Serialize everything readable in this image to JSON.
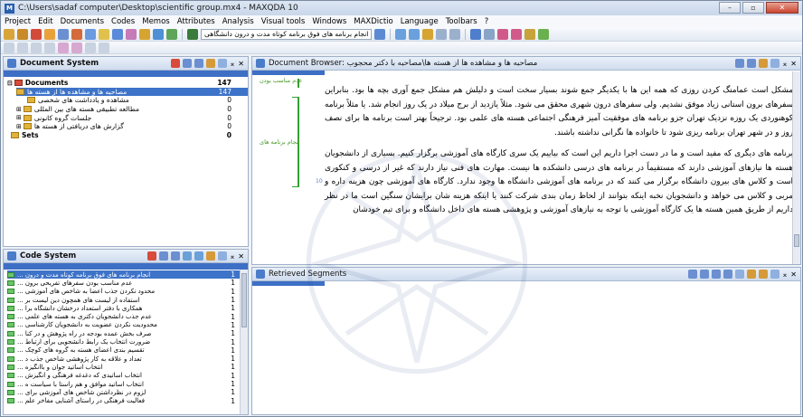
{
  "window": {
    "title": "C:\\Users\\sadaf computer\\Desktop\\scientific group.mx4 - MAXQDA 10"
  },
  "menu": [
    "Project",
    "Edit",
    "Documents",
    "Codes",
    "Memos",
    "Attributes",
    "Analysis",
    "Visual tools",
    "Windows",
    "MAXDictio",
    "Language",
    "Toolbars",
    "?"
  ],
  "toolbar": {
    "combo_label": "انجام برنامه های فوق برنامه کوتاه مدت و درون دانشگاهی"
  },
  "document_system": {
    "title": "Document System",
    "root": {
      "label": "Documents",
      "count": "147"
    },
    "items": [
      {
        "label": "مصاحبه ها و مشاهده ها از هسته ها",
        "count": "147",
        "selected": true
      },
      {
        "label": "مشاهده و یادداشت های شخصی",
        "count": "0"
      },
      {
        "label": "مطالعه تطبیقی هسته های بین المللی",
        "count": "0"
      },
      {
        "label": "جلسات گروه کانونی",
        "count": "0"
      },
      {
        "label": "گزارش های دریافتی از هسته ها",
        "count": "0"
      }
    ],
    "sets": {
      "label": "Sets",
      "count": "0"
    }
  },
  "code_system": {
    "title": "Code System",
    "items": [
      {
        "label": "انجام برنامه های فوق برنامه کوتاه مدت و درون ...",
        "count": "1",
        "selected": true
      },
      {
        "label": "عدم مناسب بودن سفرهای تفریحی برون ...",
        "count": "1"
      },
      {
        "label": "محدود نکردن جذب اعضا به شاخص های آموزشی ...",
        "count": "1"
      },
      {
        "label": "استفاده از لیست های همچون دین لیست بر ...",
        "count": "1"
      },
      {
        "label": "همکاری با دفتر استعداد درخشان دانشگاه برا ...",
        "count": "1"
      },
      {
        "label": "عدم جذب دانشجویان دکتری به هسته های علمی ...",
        "count": "1"
      },
      {
        "label": "محدودیت نکردن عضویت به دانشجویان کارشناسی ...",
        "count": "1"
      },
      {
        "label": "صرف بخش عمده بودجه در راه پژوهش و در کنا ...",
        "count": "1"
      },
      {
        "label": "ضرورت انتخاب یک رابط دانشجویی برای ارتباط ...",
        "count": "1"
      },
      {
        "label": "تقسیم بندی اعضای هسته به گروه های کوچک ...",
        "count": "1"
      },
      {
        "label": "تعداد و علاقه به کار پژوهشی شاخص جذب د ...",
        "count": "1"
      },
      {
        "label": "انتخاب اساتید جوان و باانگیزه ...",
        "count": "1"
      },
      {
        "label": "انتخاب اساتیدی که دغدغه فرهنگی و انگیزش ...",
        "count": "1"
      },
      {
        "label": "انتخاب اساتید موافق و هم راستا با سیاست ه ...",
        "count": "1"
      },
      {
        "label": "لزوم در نظرداشتن شاخص های آموزشی برای ...",
        "count": "1"
      },
      {
        "label": "فعالیت فرهنگی در راستای آشنایی مفاخر علم ...",
        "count": "1"
      }
    ]
  },
  "document_browser": {
    "title": "Document Browser: مصاحبه ها و مشاهده ها از هسته ها\\مصاحبه با دکتر محجوب",
    "code_labels": [
      "عدم مناسب بودن",
      "انجام برنامه های"
    ],
    "para_number": "10",
    "paragraphs": [
      "مشکل است عمامنگ کردن روزی که همه این ها با یکدیگر جمع شوند بسیار سخت است و دلیلش هم مشکل جمع آوری بچه ها بود. بنابراین سفرهای برون استانی زیاد موفق نشدیم. ولی سفرهای درون شهری محقق می شود. مثلاً یازدید از برج میلاد در یک روز انجام شد. یا مثلاً برنامه کوهنوردی یک روزه نزدیک تهران جزو برنامه های موفقیت آمیز فرهنگی اجتماعی هسته های علمی بود. ترجیحاً بهتر است برنامه ها برای نصف روز و در شهر تهران برنامه ریزی شود تا خانواده ها نگرانی نداشته باشند.",
      "برنامه های دیگری که مفید است و ما در دست اجرا داریم این است که بیاییم یک سری کارگاه های آموزشی برگزار کنیم. بسیاری از دانشجویان هسته ها نیازهای آموزشی دارند که مستقیماً در برنامه های درسی دانشکده ها نیست. مهارت های فنی نیاز دارند که غیر از درسی و کنکوری است و کلاس های بیرون دانشگاه برگزار می کنند که در برنامه های آموزشی دانشگاه ها وجود ندارد. کارگاه های آموزشی چون هزینه داره و مربی و کلاس می خواهد و دانشجویان نخبه اینکه بتوانند از لحاظ زمان بندی شرکت کنند یا اینکه هزینه شان برایشان سنگین است ما در نظر داریم از طریق همین هسته ها یک کارگاه آموزشی با توجه به نیازهای آموزشی و پژوهشی هسته های داخل دانشگاه و برای تیم خودشان"
    ]
  },
  "retrieved_segments": {
    "title": "Retrieved Segments"
  },
  "colors": {
    "accent": "#3d73c8",
    "code_green": "#33a033",
    "panel_header": "#cfdcee"
  }
}
